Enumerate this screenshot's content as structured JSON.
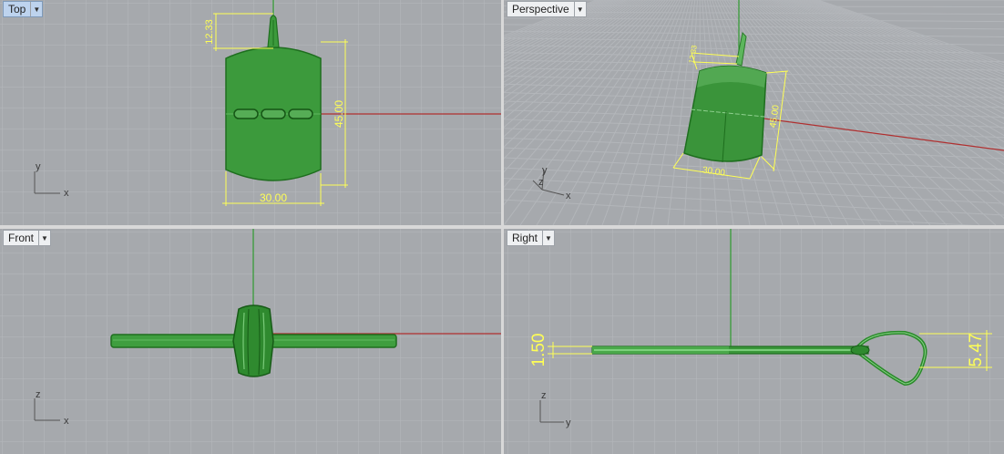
{
  "viewports": {
    "top": {
      "label": "Top",
      "dims": {
        "width": "30.00",
        "height": "45.00",
        "bail": "12.33"
      },
      "axes": {
        "h": "x",
        "v": "y"
      }
    },
    "perspective": {
      "label": "Perspective",
      "dims": {
        "width": "30.00",
        "height": "45.00",
        "bail": "12.33"
      },
      "axes": {
        "x": "x",
        "y": "y",
        "z": "z"
      }
    },
    "front": {
      "label": "Front",
      "axes": {
        "h": "x",
        "v": "z"
      }
    },
    "right": {
      "label": "Right",
      "dims": {
        "thickness": "1.50",
        "loop": "5.47"
      },
      "axes": {
        "h": "y",
        "v": "z"
      }
    }
  },
  "colors": {
    "viewport_bg": "#a6a9ad",
    "grid": "#b6b9bd",
    "grid_major": "#8d9094",
    "x_axis": "#b03030",
    "y_axis": "#2f9a2f",
    "object": "#2e8b2e",
    "dimension": "#ffff55"
  },
  "icons": {
    "dropdown": "chevron-down-icon"
  }
}
